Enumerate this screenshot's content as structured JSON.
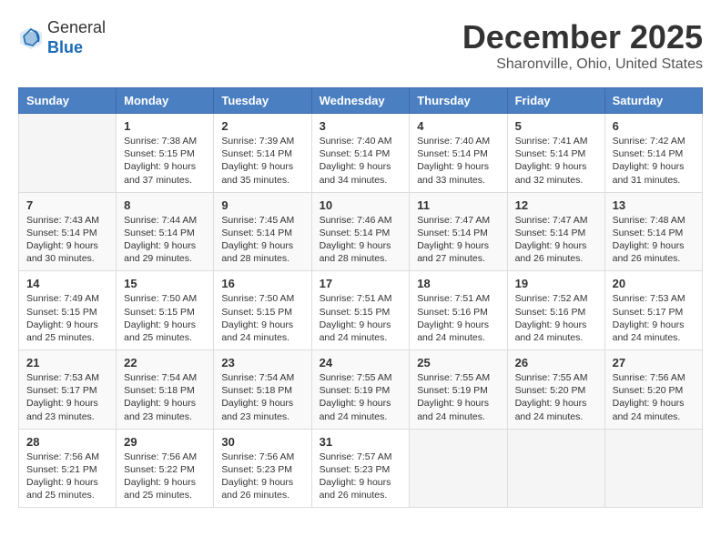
{
  "header": {
    "logo_line1": "General",
    "logo_line2": "Blue",
    "month": "December 2025",
    "location": "Sharonville, Ohio, United States"
  },
  "weekdays": [
    "Sunday",
    "Monday",
    "Tuesday",
    "Wednesday",
    "Thursday",
    "Friday",
    "Saturday"
  ],
  "weeks": [
    [
      {
        "day": "",
        "sunrise": "",
        "sunset": "",
        "daylight": ""
      },
      {
        "day": "1",
        "sunrise": "Sunrise: 7:38 AM",
        "sunset": "Sunset: 5:15 PM",
        "daylight": "Daylight: 9 hours and 37 minutes."
      },
      {
        "day": "2",
        "sunrise": "Sunrise: 7:39 AM",
        "sunset": "Sunset: 5:14 PM",
        "daylight": "Daylight: 9 hours and 35 minutes."
      },
      {
        "day": "3",
        "sunrise": "Sunrise: 7:40 AM",
        "sunset": "Sunset: 5:14 PM",
        "daylight": "Daylight: 9 hours and 34 minutes."
      },
      {
        "day": "4",
        "sunrise": "Sunrise: 7:40 AM",
        "sunset": "Sunset: 5:14 PM",
        "daylight": "Daylight: 9 hours and 33 minutes."
      },
      {
        "day": "5",
        "sunrise": "Sunrise: 7:41 AM",
        "sunset": "Sunset: 5:14 PM",
        "daylight": "Daylight: 9 hours and 32 minutes."
      },
      {
        "day": "6",
        "sunrise": "Sunrise: 7:42 AM",
        "sunset": "Sunset: 5:14 PM",
        "daylight": "Daylight: 9 hours and 31 minutes."
      }
    ],
    [
      {
        "day": "7",
        "sunrise": "Sunrise: 7:43 AM",
        "sunset": "Sunset: 5:14 PM",
        "daylight": "Daylight: 9 hours and 30 minutes."
      },
      {
        "day": "8",
        "sunrise": "Sunrise: 7:44 AM",
        "sunset": "Sunset: 5:14 PM",
        "daylight": "Daylight: 9 hours and 29 minutes."
      },
      {
        "day": "9",
        "sunrise": "Sunrise: 7:45 AM",
        "sunset": "Sunset: 5:14 PM",
        "daylight": "Daylight: 9 hours and 28 minutes."
      },
      {
        "day": "10",
        "sunrise": "Sunrise: 7:46 AM",
        "sunset": "Sunset: 5:14 PM",
        "daylight": "Daylight: 9 hours and 28 minutes."
      },
      {
        "day": "11",
        "sunrise": "Sunrise: 7:47 AM",
        "sunset": "Sunset: 5:14 PM",
        "daylight": "Daylight: 9 hours and 27 minutes."
      },
      {
        "day": "12",
        "sunrise": "Sunrise: 7:47 AM",
        "sunset": "Sunset: 5:14 PM",
        "daylight": "Daylight: 9 hours and 26 minutes."
      },
      {
        "day": "13",
        "sunrise": "Sunrise: 7:48 AM",
        "sunset": "Sunset: 5:14 PM",
        "daylight": "Daylight: 9 hours and 26 minutes."
      }
    ],
    [
      {
        "day": "14",
        "sunrise": "Sunrise: 7:49 AM",
        "sunset": "Sunset: 5:15 PM",
        "daylight": "Daylight: 9 hours and 25 minutes."
      },
      {
        "day": "15",
        "sunrise": "Sunrise: 7:50 AM",
        "sunset": "Sunset: 5:15 PM",
        "daylight": "Daylight: 9 hours and 25 minutes."
      },
      {
        "day": "16",
        "sunrise": "Sunrise: 7:50 AM",
        "sunset": "Sunset: 5:15 PM",
        "daylight": "Daylight: 9 hours and 24 minutes."
      },
      {
        "day": "17",
        "sunrise": "Sunrise: 7:51 AM",
        "sunset": "Sunset: 5:15 PM",
        "daylight": "Daylight: 9 hours and 24 minutes."
      },
      {
        "day": "18",
        "sunrise": "Sunrise: 7:51 AM",
        "sunset": "Sunset: 5:16 PM",
        "daylight": "Daylight: 9 hours and 24 minutes."
      },
      {
        "day": "19",
        "sunrise": "Sunrise: 7:52 AM",
        "sunset": "Sunset: 5:16 PM",
        "daylight": "Daylight: 9 hours and 24 minutes."
      },
      {
        "day": "20",
        "sunrise": "Sunrise: 7:53 AM",
        "sunset": "Sunset: 5:17 PM",
        "daylight": "Daylight: 9 hours and 24 minutes."
      }
    ],
    [
      {
        "day": "21",
        "sunrise": "Sunrise: 7:53 AM",
        "sunset": "Sunset: 5:17 PM",
        "daylight": "Daylight: 9 hours and 23 minutes."
      },
      {
        "day": "22",
        "sunrise": "Sunrise: 7:54 AM",
        "sunset": "Sunset: 5:18 PM",
        "daylight": "Daylight: 9 hours and 23 minutes."
      },
      {
        "day": "23",
        "sunrise": "Sunrise: 7:54 AM",
        "sunset": "Sunset: 5:18 PM",
        "daylight": "Daylight: 9 hours and 23 minutes."
      },
      {
        "day": "24",
        "sunrise": "Sunrise: 7:55 AM",
        "sunset": "Sunset: 5:19 PM",
        "daylight": "Daylight: 9 hours and 24 minutes."
      },
      {
        "day": "25",
        "sunrise": "Sunrise: 7:55 AM",
        "sunset": "Sunset: 5:19 PM",
        "daylight": "Daylight: 9 hours and 24 minutes."
      },
      {
        "day": "26",
        "sunrise": "Sunrise: 7:55 AM",
        "sunset": "Sunset: 5:20 PM",
        "daylight": "Daylight: 9 hours and 24 minutes."
      },
      {
        "day": "27",
        "sunrise": "Sunrise: 7:56 AM",
        "sunset": "Sunset: 5:20 PM",
        "daylight": "Daylight: 9 hours and 24 minutes."
      }
    ],
    [
      {
        "day": "28",
        "sunrise": "Sunrise: 7:56 AM",
        "sunset": "Sunset: 5:21 PM",
        "daylight": "Daylight: 9 hours and 25 minutes."
      },
      {
        "day": "29",
        "sunrise": "Sunrise: 7:56 AM",
        "sunset": "Sunset: 5:22 PM",
        "daylight": "Daylight: 9 hours and 25 minutes."
      },
      {
        "day": "30",
        "sunrise": "Sunrise: 7:56 AM",
        "sunset": "Sunset: 5:23 PM",
        "daylight": "Daylight: 9 hours and 26 minutes."
      },
      {
        "day": "31",
        "sunrise": "Sunrise: 7:57 AM",
        "sunset": "Sunset: 5:23 PM",
        "daylight": "Daylight: 9 hours and 26 minutes."
      },
      {
        "day": "",
        "sunrise": "",
        "sunset": "",
        "daylight": ""
      },
      {
        "day": "",
        "sunrise": "",
        "sunset": "",
        "daylight": ""
      },
      {
        "day": "",
        "sunrise": "",
        "sunset": "",
        "daylight": ""
      }
    ]
  ]
}
